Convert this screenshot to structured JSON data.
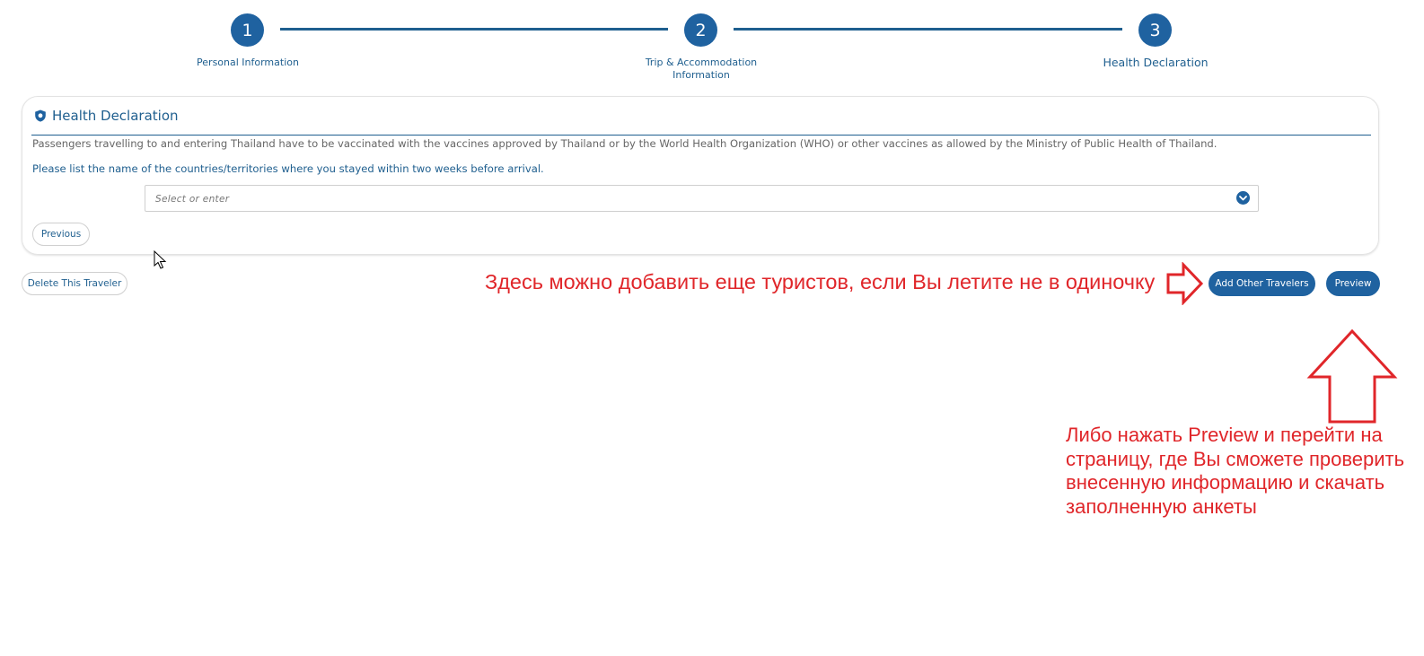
{
  "stepper": {
    "steps": [
      {
        "number": "1",
        "label": "Personal Information"
      },
      {
        "number": "2",
        "label": "Trip & Accommodation Information"
      },
      {
        "number": "3",
        "label": "Health Declaration"
      }
    ],
    "active_step": 3
  },
  "card": {
    "title": "Health Declaration",
    "title_icon": "shield-icon",
    "note": "Passengers travelling to and entering Thailand have to be vaccinated with the vaccines approved by Thailand or by the World Health Organization (WHO) or other vaccines as allowed by the Ministry of Public Health of Thailand.",
    "question": "Please list the name of the countries/territories where you stayed within two weeks before arrival.",
    "select": {
      "placeholder": "Select or enter",
      "icon": "chevron-down-icon"
    },
    "previous_label": "Previous"
  },
  "actions": {
    "delete_label": "Delete This Traveler",
    "add_travelers_label": "Add Other Travelers",
    "preview_label": "Preview"
  },
  "annotations": {
    "top_text": "Здесь можно добавить еще туристов, если Вы летите не в одиночку",
    "bottom_text": "Либо нажать Preview и перейти на страницу, где Вы сможете проверить внесенную информацию и скачать заполненную анкеты"
  },
  "colors": {
    "accent": "#1f62a0",
    "annotation": "#e0262a",
    "muted_text": "#666666"
  }
}
